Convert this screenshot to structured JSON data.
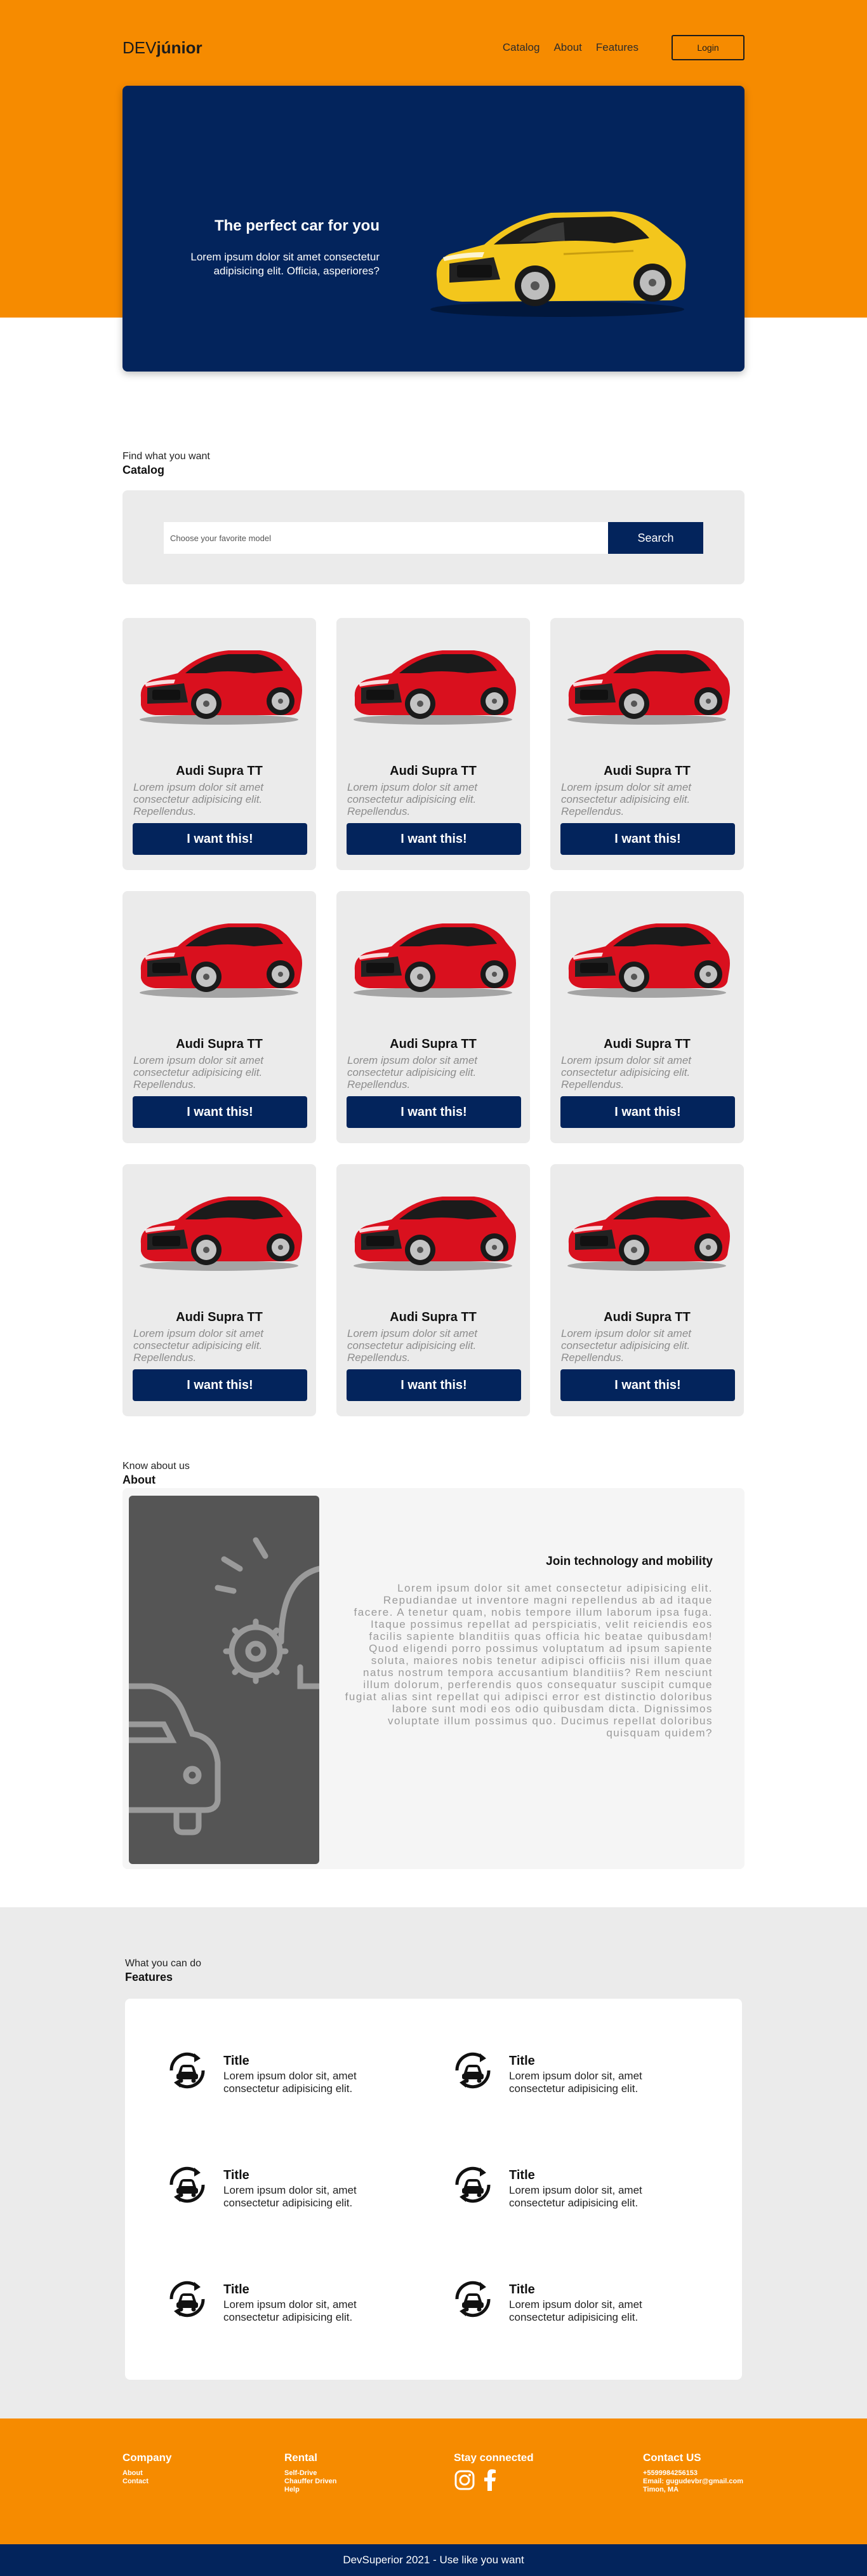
{
  "header": {
    "brand_prefix": "DEV",
    "brand_suffix": "júnior",
    "nav": [
      "Catalog",
      "About",
      "Features"
    ],
    "login_label": "Login"
  },
  "hero": {
    "title": "The perfect car for you",
    "subtitle": "Lorem ipsum dolor sit amet consectetur adipisicing elit. Officia, asperiores?"
  },
  "catalog": {
    "kicker": "Find what you want",
    "title": "Catalog",
    "search_placeholder": "Choose your favorite model",
    "search_label": "Search",
    "cards": [
      {
        "name": "Audi Supra TT",
        "desc": "Lorem ipsum dolor sit amet consectetur adipisicing elit. Repellendus.",
        "button": "I want this!"
      },
      {
        "name": "Audi Supra TT",
        "desc": "Lorem ipsum dolor sit amet consectetur adipisicing elit. Repellendus.",
        "button": "I want this!"
      },
      {
        "name": "Audi Supra TT",
        "desc": "Lorem ipsum dolor sit amet consectetur adipisicing elit. Repellendus.",
        "button": "I want this!"
      },
      {
        "name": "Audi Supra TT",
        "desc": "Lorem ipsum dolor sit amet consectetur adipisicing elit. Repellendus.",
        "button": "I want this!"
      },
      {
        "name": "Audi Supra TT",
        "desc": "Lorem ipsum dolor sit amet consectetur adipisicing elit. Repellendus.",
        "button": "I want this!"
      },
      {
        "name": "Audi Supra TT",
        "desc": "Lorem ipsum dolor sit amet consectetur adipisicing elit. Repellendus.",
        "button": "I want this!"
      },
      {
        "name": "Audi Supra TT",
        "desc": "Lorem ipsum dolor sit amet consectetur adipisicing elit. Repellendus.",
        "button": "I want this!"
      },
      {
        "name": "Audi Supra TT",
        "desc": "Lorem ipsum dolor sit amet consectetur adipisicing elit. Repellendus.",
        "button": "I want this!"
      },
      {
        "name": "Audi Supra TT",
        "desc": "Lorem ipsum dolor sit amet consectetur adipisicing elit. Repellendus.",
        "button": "I want this!"
      }
    ]
  },
  "about": {
    "kicker": "Know about us",
    "title": "About",
    "heading": "Join technology and mobility",
    "text": "Lorem ipsum dolor sit amet consectetur adipisicing elit. Repudiandae ut inventore magni repellendus ab ad itaque facere. A tenetur quam, nobis tempore illum laborum ipsa fuga. Itaque possimus repellat ad perspiciatis, velit reiciendis eos facilis sapiente blanditiis quas officia hic beatae quibusdam! Quod eligendi porro possimus voluptatum ad ipsum sapiente soluta, maiores nobis tenetur adipisci officiis nisi illum quae natus nostrum tempora accusantium blanditiis? Rem nesciunt illum dolorum, perferendis quos consequatur suscipit cumque fugiat alias sint repellat qui adipisci error est distinctio doloribus labore sunt modi eos odio quibusdam dicta. Dignissimos voluptate illum possimus quo. Ducimus repellat doloribus quisquam quidem?"
  },
  "features": {
    "kicker": "What you can do",
    "title": "Features",
    "items": [
      {
        "title": "Title",
        "text": "Lorem ipsum dolor sit, amet consectetur adipisicing elit.",
        "icon": "sync-car-icon"
      },
      {
        "title": "Title",
        "text": "Lorem ipsum dolor sit, amet consectetur adipisicing elit.",
        "icon": "sync-car-icon"
      },
      {
        "title": "Title",
        "text": "Lorem ipsum dolor sit, amet consectetur adipisicing elit.",
        "icon": "sync-car-icon"
      },
      {
        "title": "Title",
        "text": "Lorem ipsum dolor sit, amet consectetur adipisicing elit.",
        "icon": "sync-car-icon"
      },
      {
        "title": "Title",
        "text": "Lorem ipsum dolor sit, amet consectetur adipisicing elit.",
        "icon": "sync-car-icon"
      },
      {
        "title": "Title",
        "text": "Lorem ipsum dolor sit, amet consectetur adipisicing elit.",
        "icon": "sync-car-icon"
      }
    ]
  },
  "footer": {
    "company": {
      "title": "Company",
      "items": [
        "About",
        "Contact"
      ]
    },
    "rental": {
      "title": "Rental",
      "items": [
        "Self-Drive",
        "Chauffer Driven",
        "Help"
      ]
    },
    "social": {
      "title": "Stay connected",
      "icons": [
        "instagram-icon",
        "facebook-icon"
      ]
    },
    "contact": {
      "title": "Contact US",
      "items": [
        "+5599984256153",
        "Email: gugudevbr@gmail.com",
        "Timon, MA"
      ]
    },
    "copyright": "DevSuperior 2021 - Use like you want"
  },
  "colors": {
    "orange": "#f68b00",
    "navy": "#03245c",
    "card_bg": "#ebebeb",
    "car_yellow": "#f3c61c",
    "car_red": "#d9101e"
  }
}
